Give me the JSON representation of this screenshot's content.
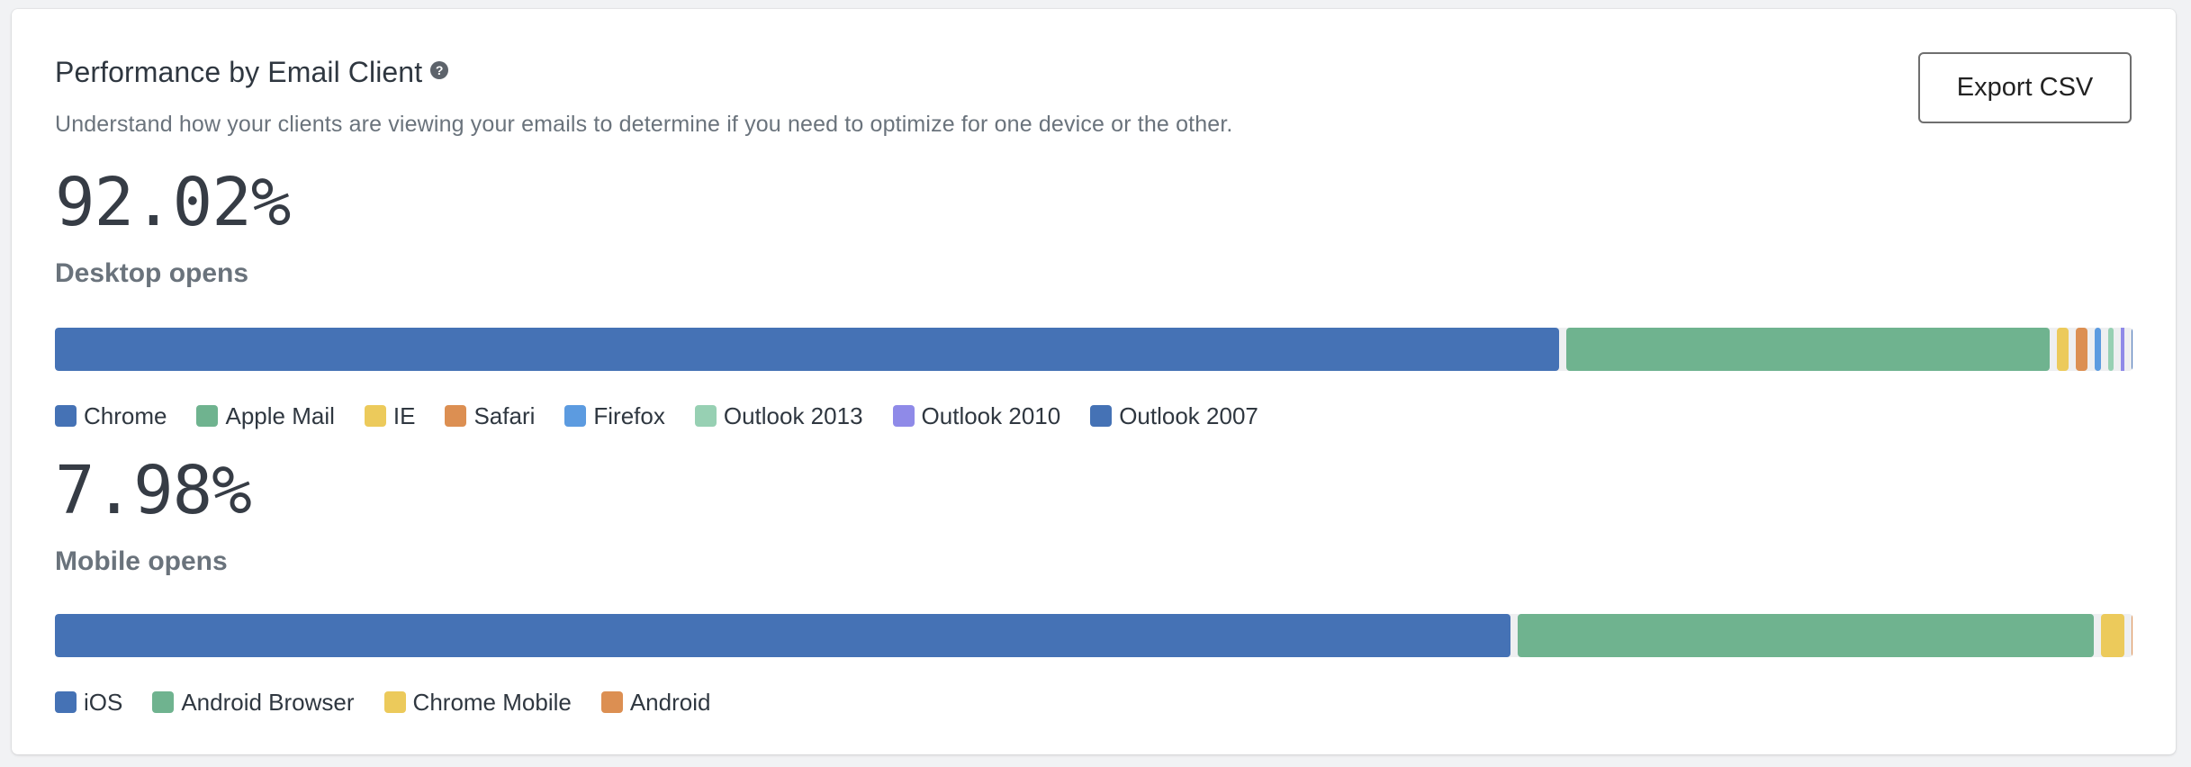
{
  "card": {
    "title": "Performance by Email Client",
    "help_icon": "question-circle-icon",
    "subtitle": "Understand how your clients are viewing your emails to determine if you need to optimize for one device or the other.",
    "export_label": "Export CSV"
  },
  "desktop": {
    "percent": "92.02%",
    "label": "Desktop opens"
  },
  "mobile": {
    "percent": "7.98%",
    "label": "Mobile opens"
  },
  "chart_data": [
    {
      "type": "bar",
      "orientation": "horizontal-stacked",
      "title": "Desktop opens",
      "total_share_percent": 92.02,
      "legend_position": "bottom-left",
      "grid": false,
      "unit": "percent of desktop opens (estimated from segment widths)",
      "categories": [
        "Chrome",
        "Apple Mail",
        "IE",
        "Safari",
        "Firefox",
        "Outlook 2013",
        "Outlook 2010",
        "Outlook 2007"
      ],
      "values": [
        74.2,
        23.8,
        0.6,
        0.55,
        0.35,
        0.25,
        0.17,
        0.05
      ],
      "colors": [
        "#4572b5",
        "#6fb38f",
        "#ecca5b",
        "#dc8f52",
        "#5c9be0",
        "#97d0b3",
        "#8f8ae8",
        "#4572b5"
      ]
    },
    {
      "type": "bar",
      "orientation": "horizontal-stacked",
      "title": "Mobile opens",
      "total_share_percent": 7.98,
      "legend_position": "bottom-left",
      "grid": false,
      "unit": "percent of mobile opens (estimated from segment widths)",
      "categories": [
        "iOS",
        "Android Browser",
        "Chrome Mobile",
        "Android"
      ],
      "values": [
        70.8,
        28.0,
        1.15,
        0.05
      ],
      "colors": [
        "#4572b5",
        "#6fb38f",
        "#ecca5b",
        "#dc8f52"
      ]
    }
  ]
}
